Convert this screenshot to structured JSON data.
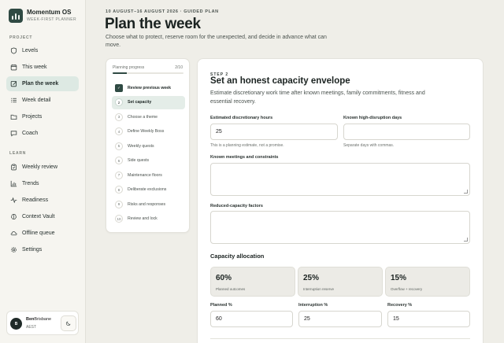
{
  "app": {
    "name": "Momentum OS",
    "subtitle": "WEEK-FIRST PLANNER"
  },
  "sidebar": {
    "sections": [
      {
        "label": "PROJECT",
        "items": [
          {
            "label": "Levels",
            "icon": "shield-icon",
            "active": false
          },
          {
            "label": "This week",
            "icon": "calendar-icon",
            "active": false
          },
          {
            "label": "Plan the week",
            "icon": "edit-icon",
            "active": true
          },
          {
            "label": "Week detail",
            "icon": "list-detail-icon",
            "active": false
          },
          {
            "label": "Projects",
            "icon": "folder-icon",
            "active": false
          },
          {
            "label": "Coach",
            "icon": "chat-icon",
            "active": false
          }
        ]
      },
      {
        "label": "LEARN",
        "items": [
          {
            "label": "Weekly review",
            "icon": "clipboard-icon",
            "active": false
          },
          {
            "label": "Trends",
            "icon": "chart-icon",
            "active": false
          },
          {
            "label": "Readiness",
            "icon": "pulse-icon",
            "active": false
          },
          {
            "label": "Context Vault",
            "icon": "brain-icon",
            "active": false
          },
          {
            "label": "Offline queue",
            "icon": "cloud-icon",
            "active": false
          },
          {
            "label": "Settings",
            "icon": "gear-icon",
            "active": false
          }
        ]
      }
    ],
    "user": {
      "initials": "B",
      "name": "Ben",
      "location": "Brisbane",
      "timezone": "AEST",
      "theme_icon": "moon-icon"
    }
  },
  "header": {
    "eyebrow": "10 AUGUST–16 AUGUST 2026 · GUIDED PLAN",
    "title": "Plan the week",
    "subtitle": "Choose what to protect, reserve room for the unexpected, and decide in advance what can move."
  },
  "steps": {
    "progress_label": "Planning progress",
    "progress_count": "2/10",
    "progress_fraction": 0.2,
    "items": [
      {
        "num": "✓",
        "label": "Review previous week",
        "state": "done"
      },
      {
        "num": "2",
        "label": "Set capacity",
        "state": "active"
      },
      {
        "num": "3",
        "label": "Choose a theme",
        "state": "todo"
      },
      {
        "num": "4",
        "label": "Define Weekly Boss",
        "state": "todo"
      },
      {
        "num": "5",
        "label": "Weekly quests",
        "state": "todo"
      },
      {
        "num": "6",
        "label": "Side quests",
        "state": "todo"
      },
      {
        "num": "7",
        "label": "Maintenance floors",
        "state": "todo"
      },
      {
        "num": "8",
        "label": "Deliberate exclusions",
        "state": "todo"
      },
      {
        "num": "9",
        "label": "Risks and responses",
        "state": "todo"
      },
      {
        "num": "10",
        "label": "Review and lock",
        "state": "todo"
      }
    ]
  },
  "form": {
    "step_label": "STEP 2",
    "title": "Set an honest capacity envelope",
    "description": "Estimate discretionary work time after known meetings, family commitments, fitness and essential recovery.",
    "hours_label": "Estimated discretionary hours",
    "hours_value": "25",
    "hours_hint": "This is a planning estimate, not a promise.",
    "disruption_label": "Known high-disruption days",
    "disruption_value": "",
    "disruption_hint": "Separate days with commas.",
    "meetings_label": "Known meetings and constraints",
    "reduced_label": "Reduced-capacity factors",
    "allocation_title": "Capacity allocation",
    "allocation": [
      {
        "value": "60%",
        "label": "Planned outcomes"
      },
      {
        "value": "25%",
        "label": "Interruption reserve"
      },
      {
        "value": "15%",
        "label": "Overflow + recovery"
      }
    ],
    "planned_label": "Planned %",
    "planned_value": "60",
    "interruption_label": "Interruption %",
    "interruption_value": "25",
    "recovery_label": "Recovery %",
    "recovery_value": "15"
  },
  "colors": {
    "accent": "#2f4a43",
    "active_bg": "#dde9e3",
    "background": "#efeee8"
  }
}
